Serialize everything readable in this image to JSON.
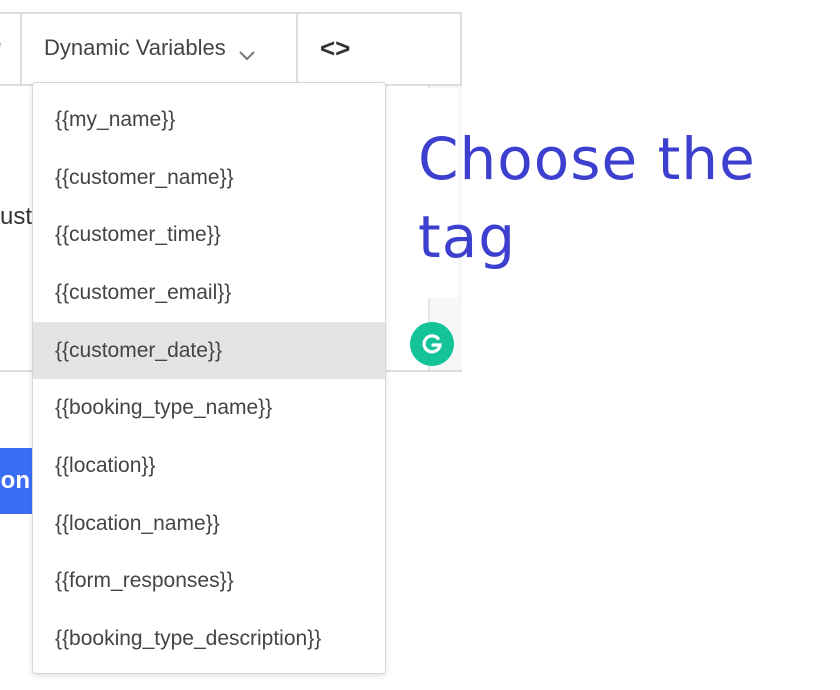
{
  "toolbar": {
    "dynamic_variables_label": "Dynamic Variables",
    "code_label": "<>"
  },
  "editor": {
    "partial_text": "ust"
  },
  "button": {
    "partial_label": "on"
  },
  "dropdown": {
    "items": [
      {
        "label": "{{my_name}}"
      },
      {
        "label": "{{customer_name}}"
      },
      {
        "label": "{{customer_time}}"
      },
      {
        "label": "{{customer_email}}"
      },
      {
        "label": "{{customer_date}}",
        "highlighted": true
      },
      {
        "label": "{{booking_type_name}}"
      },
      {
        "label": "{{location}}"
      },
      {
        "label": "{{location_name}}"
      },
      {
        "label": "{{form_responses}}"
      },
      {
        "label": "{{booking_type_description}}"
      }
    ]
  },
  "annotation": {
    "line1": "Choose the",
    "line2": "tag"
  },
  "colors": {
    "annotation": "#3d3fce",
    "highlight": "#e3e4e6",
    "button": "#3b6ef5",
    "grammarly": "#15c39a"
  },
  "icons": [
    "chevron-down-icon",
    "code-icon",
    "grammarly-icon"
  ]
}
